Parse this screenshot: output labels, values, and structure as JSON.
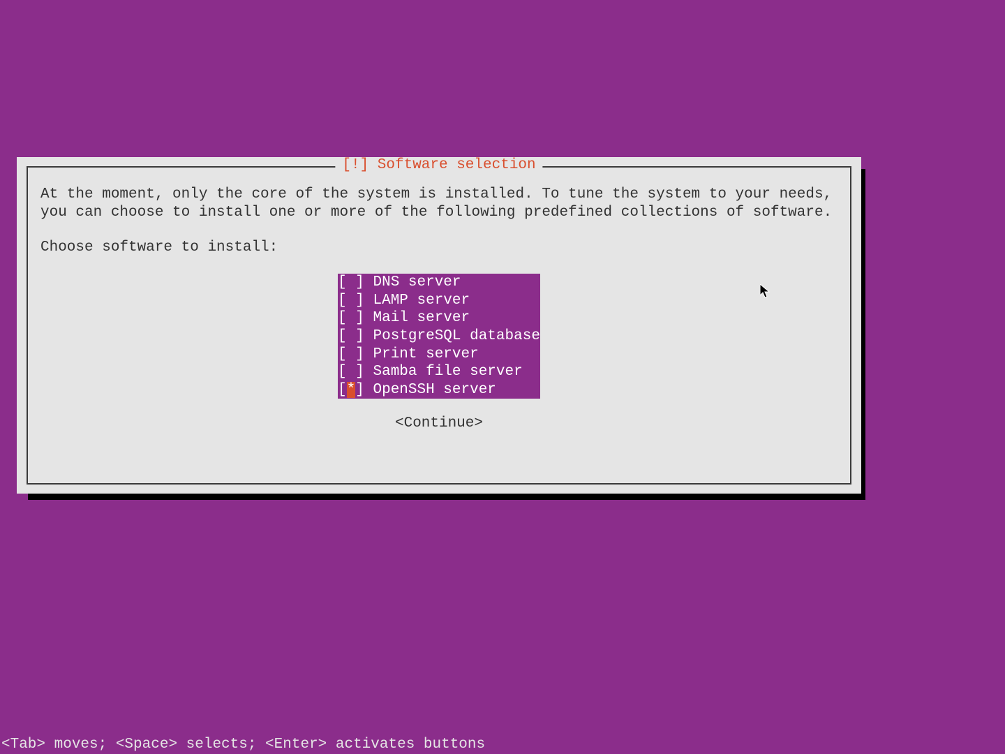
{
  "dialog": {
    "title": "[!] Software selection",
    "description": "At the moment, only the core of the system is installed. To tune the system to your needs, you can choose to install one or more of the following predefined collections of software.",
    "prompt": "Choose software to install:",
    "options": [
      {
        "label": "DNS server",
        "checked": false,
        "cursor": false
      },
      {
        "label": "LAMP server",
        "checked": false,
        "cursor": false
      },
      {
        "label": "Mail server",
        "checked": false,
        "cursor": false
      },
      {
        "label": "PostgreSQL database",
        "checked": false,
        "cursor": false
      },
      {
        "label": "Print server",
        "checked": false,
        "cursor": false
      },
      {
        "label": "Samba file server",
        "checked": false,
        "cursor": false
      },
      {
        "label": "OpenSSH server",
        "checked": true,
        "cursor": true
      }
    ],
    "continue_label": "<Continue>"
  },
  "footer": "<Tab> moves; <Space> selects; <Enter> activates buttons",
  "glyphs": {
    "checkbox_left": "[",
    "checkbox_right": "] ",
    "checked": "*",
    "unchecked": " "
  }
}
